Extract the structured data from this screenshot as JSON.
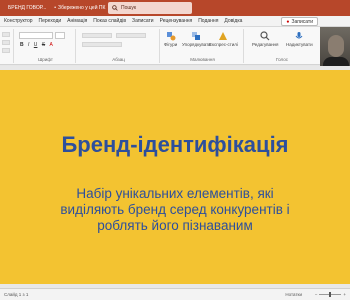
{
  "titlebar": {
    "document_title": "БРЕНД ГОВОР...",
    "saved_status": "Збережено у цей ПК",
    "search_placeholder": "Пошук"
  },
  "tabs": [
    "Конструктор",
    "Переходи",
    "Анімація",
    "Показ слайдів",
    "Записати",
    "Рецензування",
    "Подання",
    "Довідка"
  ],
  "share_label": "Записати",
  "ribbon": {
    "groups": {
      "font": "Шрифт",
      "paragraph": "Абзац",
      "drawing": "Малювання",
      "voice": "Голос"
    },
    "buttons": {
      "shapes": "Фігури",
      "arrange": "Упорядкувати",
      "quick_styles": "Експрес-стилі",
      "editing": "Редагування",
      "dictate": "Надиктувати"
    }
  },
  "slide": {
    "title": "Бренд-ідентифікація",
    "subtitle": "Набір унікальних елементів, які виділяють бренд серед конкурентів і роблять його пізнаваним"
  },
  "status": {
    "slide_info": "Слайд 1 з 1",
    "notes": "Нотатки",
    "zoom": ""
  },
  "colors": {
    "titlebar": "#b7472a",
    "slide_bg": "#f3c331",
    "slide_text": "#2d4f9c"
  }
}
